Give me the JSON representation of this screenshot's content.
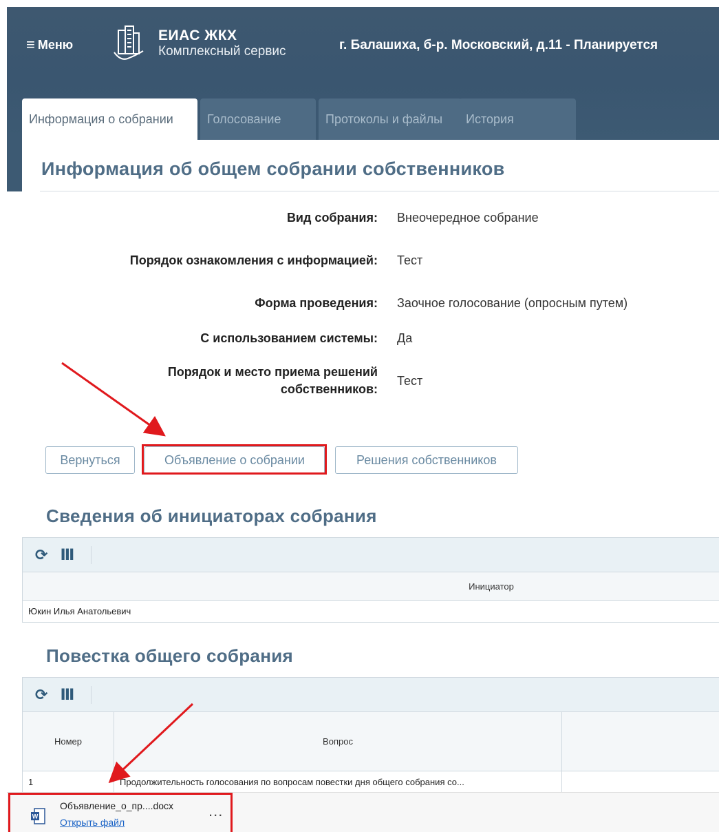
{
  "header": {
    "menu_label": "Меню",
    "brand_title": "ЕИАС ЖКХ",
    "brand_subtitle": "Комплексный сервис",
    "address": "г. Балашиха, б-р. Московский, д.11 - Планируется"
  },
  "tabs": [
    {
      "label": "Информация о собрании",
      "active": true
    },
    {
      "label": "Голосование",
      "active": false
    },
    {
      "label": "Протоколы и файлы",
      "active": false
    },
    {
      "label": "История",
      "active": false
    }
  ],
  "info": {
    "title": "Информация об общем собрании собственников",
    "fields": [
      {
        "label": "Вид собрания:",
        "value": "Внеочередное собрание"
      },
      {
        "label": "Порядок ознакомления с информацией:",
        "value": "Тест"
      },
      {
        "label": "Форма проведения:",
        "value": "Заочное голосование (опросным путем)"
      },
      {
        "label": "С использованием системы:",
        "value": "Да"
      },
      {
        "label_line1": "Порядок и место приема решений",
        "label_line2": "собственников:",
        "value": "Тест"
      }
    ]
  },
  "buttons": {
    "back": "Вернуться",
    "announcement": "Объявление о собрании",
    "decisions": "Решения собственников"
  },
  "initiators": {
    "title": "Сведения об инициаторах собрания",
    "column": "Инициатор",
    "rows": [
      "Юкин Илья Анатольевич"
    ]
  },
  "agenda": {
    "title": "Повестка общего собрания",
    "columns": [
      "Номер",
      "Вопрос"
    ],
    "rows": [
      {
        "num": "1",
        "question": "Продолжительность голосования по вопросам повестки дня общего собрания со..."
      }
    ]
  },
  "download": {
    "filename": "Объявление_о_пр....docx",
    "open_label": "Открыть файл",
    "more": "..."
  },
  "colors": {
    "header_bg": "#3d5a73",
    "title_color": "#4f6d86",
    "highlight": "#e0191d",
    "link": "#1a63c6"
  }
}
